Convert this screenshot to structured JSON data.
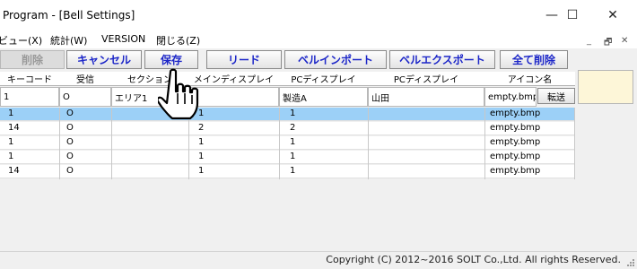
{
  "window": {
    "title": "Program - [Bell Settings]",
    "controls": {
      "minimize": "—",
      "maximize": "☐",
      "close": "✕"
    }
  },
  "menu": {
    "items": [
      "ビュー(X)",
      "統計(W)",
      "VERSION",
      "閉じる(Z)"
    ],
    "mdi": {
      "minimize": "_",
      "restore": "🗗",
      "close": "✕"
    }
  },
  "toolbar": {
    "buttons": [
      "削除",
      "キャンセル",
      "保存",
      "リード",
      "ベルインポート",
      "ベルエクスポート",
      "全て削除"
    ]
  },
  "table": {
    "headers": [
      "キーコード",
      "受信",
      "セクション",
      "メインディスプレイ",
      "PCディスプレイ",
      "PCディスプレイ",
      "アイコン名"
    ],
    "edit_row": [
      "1",
      "O",
      "エリア1",
      "",
      "製造A",
      "山田",
      "empty.bmp"
    ],
    "convert_label": "転送",
    "rows": [
      [
        "1",
        "O",
        "",
        "1",
        "1",
        "",
        "empty.bmp"
      ],
      [
        "14",
        "O",
        "",
        "2",
        "2",
        "",
        "empty.bmp"
      ],
      [
        "1",
        "O",
        "",
        "1",
        "1",
        "",
        "empty.bmp"
      ],
      [
        "1",
        "O",
        "",
        "1",
        "1",
        "",
        "empty.bmp"
      ],
      [
        "14",
        "O",
        "",
        "1",
        "1",
        "",
        "empty.bmp"
      ]
    ],
    "selected_row": 0
  },
  "status": {
    "copyright": "Copyright (C) 2012~2016 SOLT Co.,Ltd. All rights Reserved."
  },
  "colors": {
    "button_text": "#1c26c8",
    "selection": "#9cd0f7",
    "yellow_panel": "#fdf6d8"
  }
}
